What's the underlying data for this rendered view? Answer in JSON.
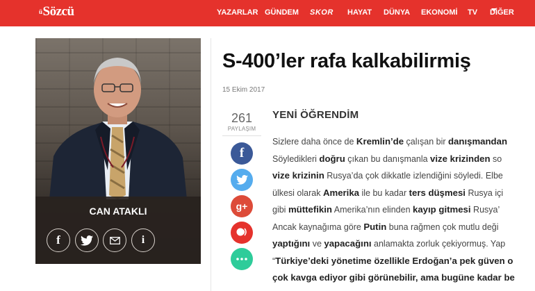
{
  "header": {
    "logo_prefix": "ü",
    "logo": "Sözcü",
    "nav": [
      {
        "label": "YAZARLAR"
      },
      {
        "label": "GÜNDEM"
      },
      {
        "label": "SKOR"
      },
      {
        "label": "HAYAT"
      },
      {
        "label": "DÜNYA"
      },
      {
        "label": "EKONOMİ"
      },
      {
        "label": "TV"
      },
      {
        "label": "DİĞER"
      }
    ]
  },
  "author": {
    "name": "CAN ATAKLI",
    "social": [
      "facebook-icon",
      "twitter-icon",
      "mail-icon",
      "info-icon"
    ]
  },
  "article": {
    "title": "S-400’ler rafa kalkabilirmiş",
    "date": "15 Ekim 2017",
    "share_count": "261",
    "share_label": "PAYLAŞIM",
    "share_buttons": [
      {
        "icon": "facebook-icon",
        "color": "#3b5998"
      },
      {
        "icon": "twitter-icon",
        "color": "#55acee"
      },
      {
        "icon": "google-plus-icon",
        "color": "#dd4b39"
      },
      {
        "icon": "speech-icon",
        "color": "#e5322c"
      },
      {
        "icon": "more-icon",
        "color": "#2ecc9a"
      }
    ],
    "subheading": "YENİ ÖĞRENDİM",
    "lines": [
      [
        "Sizlere daha önce de ",
        "Kremlin’de",
        " çalışan bir ",
        "danışmandan",
        ""
      ],
      [
        "Söyledikleri ",
        "doğru",
        " çıkan bu danışmanla ",
        "vize krizinden",
        " so"
      ],
      [
        "",
        "vize krizinin",
        " Rusya’da çok dikkatle izlendiğini söyledi. Elbe",
        "",
        ""
      ],
      [
        "ülkesi olarak ",
        "Amerika",
        " ile bu kadar ",
        "ters düşmesi",
        " Rusya içi"
      ],
      [
        "gibi ",
        "müttefikin",
        " Amerika’nın elinden ",
        "kayıp gitmesi",
        " Rusya’"
      ],
      [
        "Ancak kaynağıma göre ",
        "Putin",
        " buna rağmen çok mutlu deği",
        "",
        ""
      ],
      [
        "",
        "yaptığını",
        " ve ",
        "yapacağını",
        " anlamakta zorluk çekiyormuş. Yap"
      ],
      [
        "“",
        "Türkiye’deki yönetime özellikle Erdoğan’a pek güven o",
        "",
        "",
        ""
      ],
      [
        "",
        "çok kavga ediyor gibi görünebilir, ama bugüne kadar be",
        "",
        "",
        ""
      ]
    ]
  },
  "colors": {
    "brand": "#e5322c",
    "text": "#444444"
  }
}
